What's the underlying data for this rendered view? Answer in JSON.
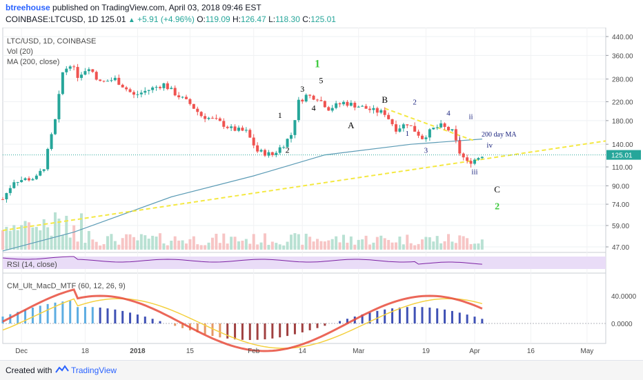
{
  "header": {
    "author": "btreehouse",
    "published_text": "published on TradingView.com, April 03, 2018 09:46 EST",
    "symbol_line": "COINBASE:LTCUSD, 1D",
    "last": "125.01",
    "change": "+5.91 (+4.96%)",
    "o_label": "O:",
    "o": "119.09",
    "h_label": "H:",
    "h": "126.47",
    "l_label": "L:",
    "l": "118.30",
    "c_label": "C:",
    "c": "125.01"
  },
  "legends": {
    "main_title": "LTC/USD, 1D, COINBASE",
    "vol": "Vol (20)",
    "ma": "MA (200, close)",
    "rsi": "RSI (14, close)",
    "macd": "CM_Ult_MacD_MTF (60, 12, 26, 9)"
  },
  "footer": {
    "created_with": "Created with",
    "brand": "TradingView"
  },
  "colors": {
    "up": "#26a69a",
    "down": "#ef5350",
    "ma_line": "#5b9bb5",
    "trend": "#f4e842",
    "rsi_band": "#e9dcf7",
    "rsi_line": "#7b1fa2"
  },
  "chart_data": [
    {
      "type": "candlestick",
      "title": "LTC/USD, 1D, COINBASE",
      "y_scale": "log",
      "y_ticks": [
        "440.00",
        "360.00",
        "280.00",
        "220.00",
        "180.00",
        "140.00",
        "110.00",
        "90.00",
        "74.00",
        "59.00",
        "47.00"
      ],
      "last_price_label": "125.01",
      "x_ticks": [
        "Dec",
        "18",
        "2018",
        "15",
        "Feb",
        "14",
        "Mar",
        "19",
        "Apr",
        "16",
        "May"
      ],
      "date_range": [
        "2017-11-26",
        "2018-05-06"
      ],
      "ohlc_sample": [
        {
          "date": "2017-12-12",
          "close": 300
        },
        {
          "date": "2017-12-19",
          "close": 320
        },
        {
          "date": "2018-01-15",
          "close": 215
        },
        {
          "date": "2018-02-06",
          "close": 125
        },
        {
          "date": "2018-02-18",
          "close": 230
        },
        {
          "date": "2018-03-18",
          "close": 150
        },
        {
          "date": "2018-04-01",
          "close": 119
        },
        {
          "date": "2018-04-03",
          "close": 125.01
        }
      ],
      "ma_200_label": "200 day MA",
      "wave_labels": [
        "1",
        "2",
        "3",
        "4",
        "5",
        "1",
        "A",
        "B",
        "1",
        "2",
        "3",
        "4",
        "i",
        "ii",
        "iii",
        "iv",
        "C",
        "2"
      ]
    },
    {
      "type": "bar",
      "title": "Vol (20)"
    },
    {
      "type": "line",
      "title": "RSI (14, close)"
    },
    {
      "type": "bar",
      "title": "CM_Ult_MacD_MTF (60, 12, 26, 9)",
      "y_ticks": [
        "40.0000",
        "0.0000"
      ]
    }
  ]
}
